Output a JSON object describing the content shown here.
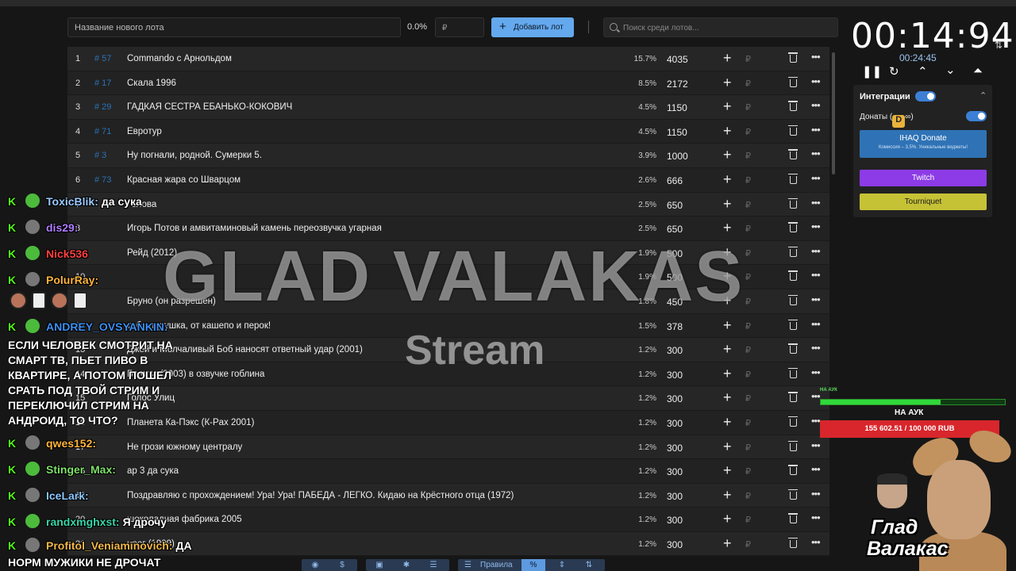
{
  "toolbar": {
    "lot_placeholder": "Название нового лота",
    "percent": "0.0%",
    "rub_symbol": "₽",
    "add_label": "Добавить лот",
    "search_placeholder": "Поиск среди лотов..."
  },
  "lots": [
    {
      "rank": "1",
      "id": "# 57",
      "name": "Commando с Арнольдом",
      "pct": "15.7%",
      "amount": "4035"
    },
    {
      "rank": "2",
      "id": "# 17",
      "name": "Скала 1996",
      "pct": "8.5%",
      "amount": "2172"
    },
    {
      "rank": "3",
      "id": "# 29",
      "name": "ГАДКАЯ СЕСТРА ЕБАНЬКО-КОКОВИЧ",
      "pct": "4.5%",
      "amount": "1150"
    },
    {
      "rank": "4",
      "id": "# 71",
      "name": "Евротур",
      "pct": "4.5%",
      "amount": "1150"
    },
    {
      "rank": "5",
      "id": "# 3",
      "name": "Ну погнали, родной. Сумерки 5.",
      "pct": "3.9%",
      "amount": "1000"
    },
    {
      "rank": "6",
      "id": "# 73",
      "name": "Красная жара со Шварцом",
      "pct": "2.6%",
      "amount": "666"
    },
    {
      "rank": "7",
      "id": "",
      "name": "Голова",
      "pct": "2.5%",
      "amount": "650"
    },
    {
      "rank": "8",
      "id": "",
      "name": "Игорь Потов и амвитаминовый камень переозвучка угарная",
      "pct": "2.5%",
      "amount": "650"
    },
    {
      "rank": "9",
      "id": "",
      "name": "Рейд (2012)",
      "pct": "1.9%",
      "amount": "500"
    },
    {
      "rank": "10",
      "id": "",
      "name": "",
      "pct": "1.9%",
      "amount": "500"
    },
    {
      "rank": "11",
      "id": "",
      "name": "Бруно (он разрешен)",
      "pct": "1.8%",
      "amount": "450"
    },
    {
      "rank": "12",
      "id": "",
      "name": "тебе дедушка, от кашепо и перок!",
      "pct": "1.5%",
      "amount": "378"
    },
    {
      "rank": "13",
      "id": "",
      "name": "Джей и Молчаливый Боб наносят ответный удар (2001)",
      "pct": "1.2%",
      "amount": "300"
    },
    {
      "rank": "14",
      "id": "",
      "name": "Банита (2003) в озвучке гоблина",
      "pct": "1.2%",
      "amount": "300"
    },
    {
      "rank": "15",
      "id": "",
      "name": "Голос Улиц",
      "pct": "1.2%",
      "amount": "300"
    },
    {
      "rank": "16",
      "id": "",
      "name": "Планета Ка-Пэкс (К-Pax 2001)",
      "pct": "1.2%",
      "amount": "300"
    },
    {
      "rank": "17",
      "id": "",
      "name": "Не грози южному централу",
      "pct": "1.2%",
      "amount": "300"
    },
    {
      "rank": "18",
      "id": "",
      "name": "ар 3 да сука",
      "pct": "1.2%",
      "amount": "300"
    },
    {
      "rank": "19",
      "id": "",
      "name": "Поздравляю с прохождением! Ура! Ура! ПАБЕДА - ЛЕГКО. Кидаю на Крёстного отца (1972)",
      "pct": "1.2%",
      "amount": "300"
    },
    {
      "rank": "20",
      "id": "",
      "name": "шоколадная фабрика 2005",
      "pct": "1.2%",
      "amount": "300"
    },
    {
      "rank": "21",
      "id": "",
      "name": "ирог (1999)",
      "pct": "1.2%",
      "amount": "300"
    }
  ],
  "stream": {
    "title": "GLAD VALAKAS",
    "subtitle": "Stream"
  },
  "chat": [
    {
      "user": "ToxicBlik:",
      "color": "#9bc9ff",
      "msg": "да сука"
    },
    {
      "user": "dis29:",
      "color": "#b07cff",
      "msg": ""
    },
    {
      "user": "Nick536",
      "color": "#ff4040",
      "msg": ""
    },
    {
      "user": "PolurRay:",
      "color": "#ffb53a",
      "msg": ""
    },
    {
      "user": "ANDREY_OVSYANKIN:",
      "color": "#3d8ff0",
      "msg": ""
    },
    {
      "user": "qwes152:",
      "color": "#ffb43c",
      "msg": ""
    },
    {
      "user": "Stinger_Max:",
      "color": "#7fe06a",
      "msg": ""
    },
    {
      "user": "IceLark:",
      "color": "#8cc8ff",
      "msg": ""
    },
    {
      "user": "randxmghxst:",
      "color": "#39d6a8",
      "msg": "Я дрочу"
    },
    {
      "user": "Profitol_Veniaminovich:",
      "color": "#f2b84a",
      "msg": "ДА"
    }
  ],
  "chat_block": "ЕСЛИ ЧЕЛОВЕК СМОТРИТ НА СМАРТ ТВ, ПЬЕТ ПИВО В КВАРТИРЕ, А ПОТОМ ПОШЕЛ СРАТЬ ПОД ТВОЙ СТРИМ И ПЕРЕКЛЮЧИЛ СТРИМ НА АНДРОИД, ТО ЧТО?",
  "chat_last": "НОРМ МУЖИКИ НЕ ДРОЧАТ",
  "bottom": {
    "rules_label": "Правила",
    "percent_symbol": "%"
  },
  "timer": {
    "main": "00:14:94",
    "sub": "00:24:45"
  },
  "panel": {
    "title": "Интеграции",
    "donate_label": "Донаты (",
    "donate_suffix": ")",
    "ihaq_label": "IHAQ Donate",
    "ihaq_sub": "Комиссия – 3,5%. Уникальные виджеты!",
    "twitch_label": "Twitch",
    "tourniquet_label": "Tourniquet"
  },
  "progress": {
    "small_label": "НА АУК",
    "title": "НА АУК",
    "amount": "155 602.51 / 100 000 RUB",
    "fraction": 0.65
  },
  "brand": {
    "line1": "Глад",
    "line2": "Валакас"
  },
  "colors": {
    "accent": "#64a8ee",
    "twitch": "#8c3be6",
    "tourniquet": "#c6c236",
    "ihaq": "#2f73b6",
    "progress": "#30d83a",
    "goal_red": "#d8262c"
  }
}
